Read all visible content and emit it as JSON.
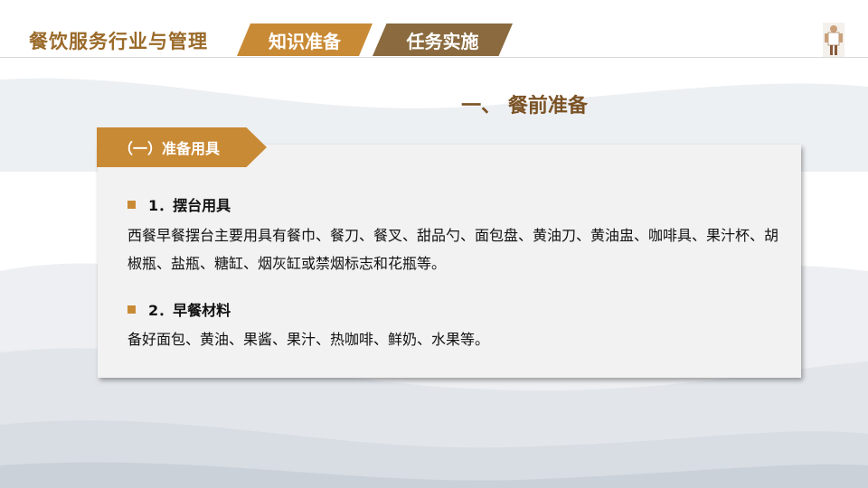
{
  "header": {
    "course_title": "餐饮服务行业与管理",
    "tabs": [
      {
        "label": "知识准备"
      },
      {
        "label": "任务实施"
      }
    ]
  },
  "section_title": "一、 餐前准备",
  "card": {
    "tag": "（一）准备用具",
    "items": [
      {
        "heading": "1．摆台用具",
        "text": "西餐早餐摆台主要用具有餐巾、餐刀、餐叉、甜品勺、面包盘、黄油刀、黄油盅、咖啡具、果汁杯、胡椒瓶、盐瓶、糖缸、烟灰缸或禁烟标志和花瓶等。"
      },
      {
        "heading": "2．早餐材料",
        "text": "备好面包、黄油、果酱、果汁、热咖啡、鲜奶、水果等。"
      }
    ]
  },
  "colors": {
    "accent": "#c98a35",
    "accent_dark": "#8a6a3e",
    "title_brown": "#7a5225"
  },
  "icons": {
    "bullet": "square-bullet-icon",
    "figure": "chef-figure-icon"
  }
}
